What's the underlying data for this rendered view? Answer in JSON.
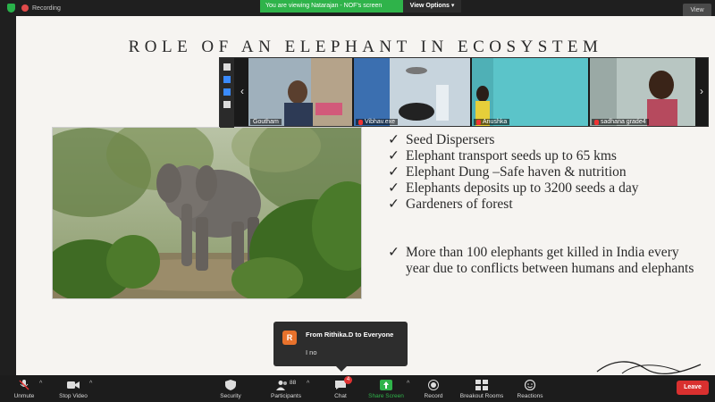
{
  "topbar": {
    "recording_label": "Recording",
    "banner_text": "You are viewing Natarajan - NOF's screen",
    "view_options": "View Options",
    "view_button": "View"
  },
  "slide": {
    "title": "ROLE OF AN ELEPHANT IN ECOSYSTEM",
    "bullets_group1": [
      "Seed Dispersers",
      "Elephant transport seeds up to 65 kms",
      "Elephant Dung –Safe haven & nutrition",
      "Elephants deposits up to 3200 seeds a day",
      "Gardeners of forest"
    ],
    "bullets_group2": [
      "More than 100 elephants get killed in India every year due to conflicts between humans and elephants"
    ],
    "check_glyph": "✓"
  },
  "video_strip": {
    "participants": [
      {
        "name": "Goutham",
        "mic_muted": false
      },
      {
        "name": "Vibhav.exe",
        "mic_muted": true
      },
      {
        "name": "Anushka",
        "mic_muted": true
      },
      {
        "name": "sadhana grade4",
        "mic_muted": true
      }
    ]
  },
  "chat_popup": {
    "avatar_letter": "R",
    "from": "From Rithika.D to Everyone",
    "message": "I no"
  },
  "toolbar": {
    "unmute": "Unmute",
    "stop_video": "Stop Video",
    "security": "Security",
    "participants": "Participants",
    "participants_count": "88",
    "chat": "Chat",
    "chat_badge": "4",
    "share_screen": "Share Screen",
    "record": "Record",
    "breakout_rooms": "Breakout Rooms",
    "reactions": "Reactions",
    "leave": "Leave"
  },
  "colors": {
    "share_green": "#2fb34a",
    "leave_red": "#d9302f",
    "slide_bg": "#f6f4f1"
  }
}
